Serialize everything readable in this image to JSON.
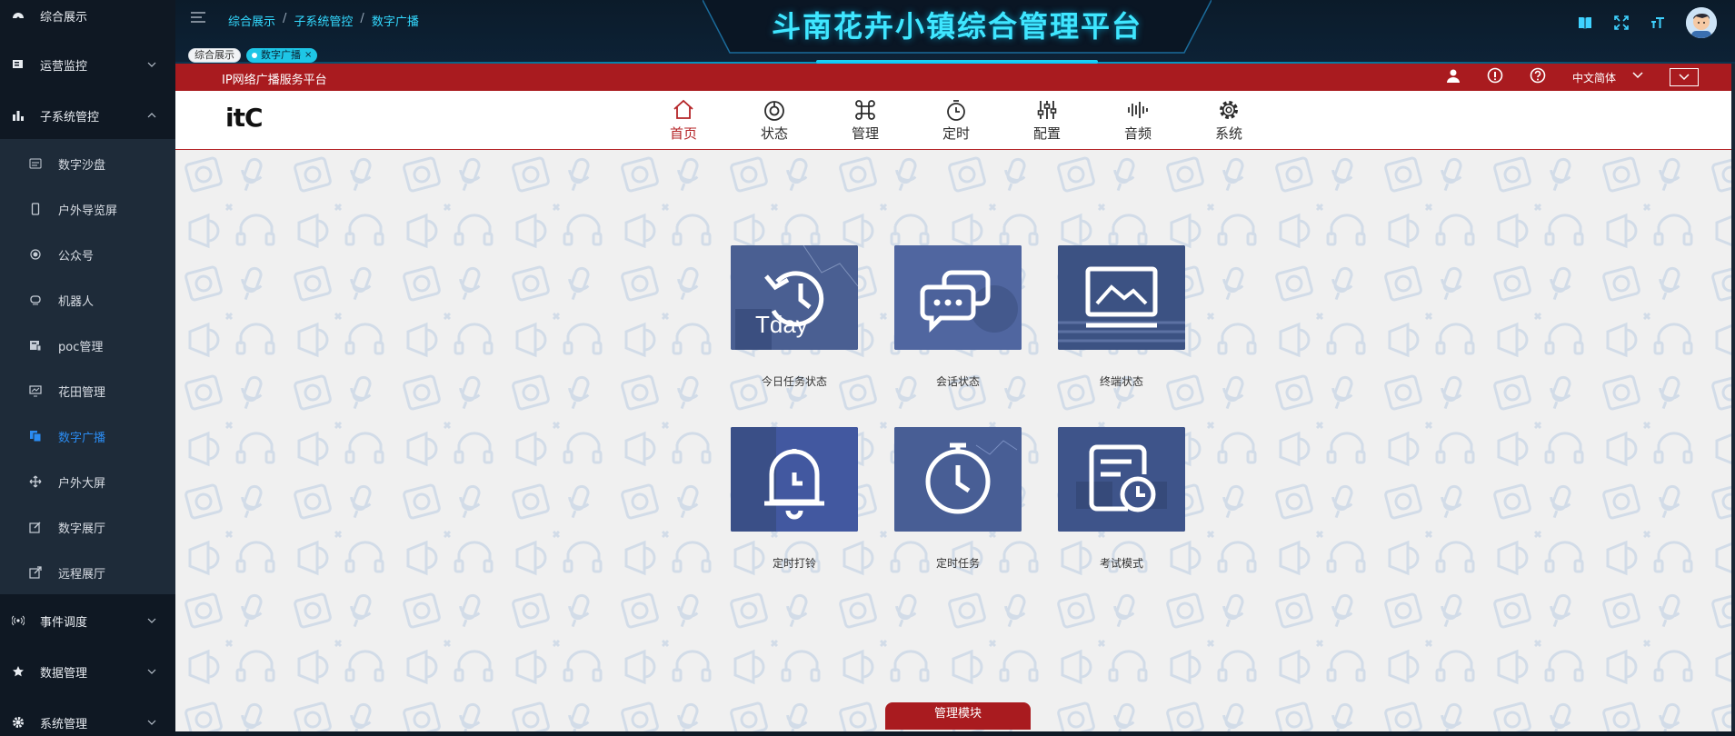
{
  "header": {
    "title": "斗南花卉小镇综合管理平台",
    "breadcrumb": [
      "综合展示",
      "子系统管控",
      "数字广播"
    ],
    "tags": [
      {
        "label": "综合展示",
        "active": false
      },
      {
        "label": "数字广播",
        "active": true,
        "close": "×"
      }
    ],
    "icons": [
      "book-icon",
      "fullscreen-icon",
      "font-size-icon",
      "avatar"
    ]
  },
  "sidebar": {
    "groups": [
      {
        "label": "综合展示",
        "icon": "dashboard-icon"
      },
      {
        "label": "运营监控",
        "icon": "monitor-icon"
      },
      {
        "label": "子系统管控",
        "icon": "bar-chart-icon",
        "expanded": true
      },
      {
        "label": "事件调度",
        "icon": "broadcast-icon"
      },
      {
        "label": "数据管理",
        "icon": "star-icon"
      },
      {
        "label": "系统管理",
        "icon": "gear-icon"
      }
    ],
    "subitems": [
      {
        "label": "数字沙盘",
        "icon": "sandbox-icon"
      },
      {
        "label": "户外导览屏",
        "icon": "phone-icon"
      },
      {
        "label": "公众号",
        "icon": "circle-dot-icon"
      },
      {
        "label": "机器人",
        "icon": "robot-icon"
      },
      {
        "label": "poc管理",
        "icon": "device-icon"
      },
      {
        "label": "花田管理",
        "icon": "screen-chart-icon"
      },
      {
        "label": "数字广播",
        "icon": "copy-icon",
        "active": true
      },
      {
        "label": "户外大屏",
        "icon": "move-icon"
      },
      {
        "label": "数字展厅",
        "icon": "edit-icon"
      },
      {
        "label": "远程展厅",
        "icon": "external-link-icon"
      }
    ]
  },
  "broadcast": {
    "platform_title": "IP网络广播服务平台",
    "language": "中文简体",
    "logo": "itC",
    "nav": [
      {
        "label": "首页",
        "icon": "home-icon",
        "active": true
      },
      {
        "label": "状态",
        "icon": "status-icon"
      },
      {
        "label": "管理",
        "icon": "manage-icon"
      },
      {
        "label": "定时",
        "icon": "timer-icon"
      },
      {
        "label": "配置",
        "icon": "sliders-icon"
      },
      {
        "label": "音频",
        "icon": "audio-icon"
      },
      {
        "label": "系统",
        "icon": "gear-icon"
      }
    ],
    "tiles": [
      {
        "label": "今日任务状态",
        "icon": "today-history-icon",
        "icon_text": "Tday"
      },
      {
        "label": "会话状态",
        "icon": "chat-icon"
      },
      {
        "label": "终端状态",
        "icon": "monitor-chart-icon"
      },
      {
        "label": "定时打铃",
        "icon": "alarm-bell-icon"
      },
      {
        "label": "定时任务",
        "icon": "stopwatch-icon"
      },
      {
        "label": "考试模式",
        "icon": "exam-clock-icon"
      }
    ],
    "module_tab": "管理模块"
  },
  "colors": {
    "sidebar_bg": "#0f1823",
    "submenu_bg": "#1e2b39",
    "active_blue": "#2b8cf2",
    "title_cyan": "#3fe6ff",
    "brand_red": "#a91b1f",
    "tile_blue": "#4a6197"
  }
}
